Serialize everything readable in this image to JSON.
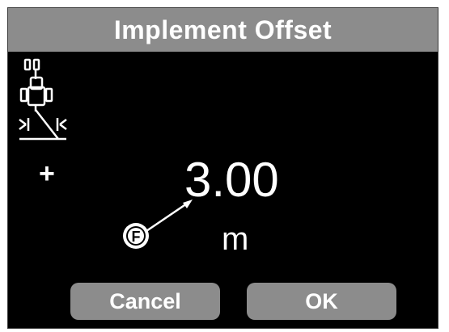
{
  "dialog": {
    "title": "Implement Offset",
    "offset_sign": "+",
    "offset_value": "3.00",
    "offset_unit": "m",
    "callout_letter": "F",
    "implement_icon": "tractor-implement-offset-icon"
  },
  "buttons": {
    "cancel_label": "Cancel",
    "ok_label": "OK"
  },
  "colors": {
    "background": "#000000",
    "bar": "#8c8c8c",
    "text": "#ffffff"
  }
}
